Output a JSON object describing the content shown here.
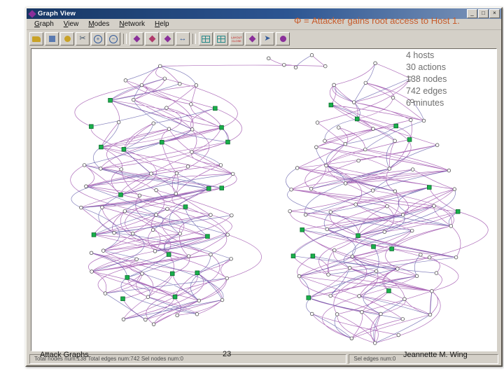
{
  "slide": {
    "title_overlay": "Φ = Attacker gains root access to Host 1.",
    "stats": [
      "4 hosts",
      "30 actions",
      "138 nodes",
      "742 edges",
      "6 minutes"
    ],
    "footer_left": "Attack Graphs",
    "footer_center": "23",
    "footer_right": "Jeannette M. Wing"
  },
  "window": {
    "title": "Graph View",
    "controls": {
      "minimize": "_",
      "maximize": "□",
      "close": "×"
    },
    "menus": [
      "Graph",
      "View",
      "Modes",
      "Network",
      "Help"
    ],
    "toolbar": {
      "layout_label": "LAYOUT",
      "close_label": "CLOSE",
      "icons": [
        {
          "name": "open-graph-icon",
          "shape": "folder",
          "color": "#c9a227"
        },
        {
          "name": "save-graph-icon",
          "shape": "square",
          "color": "#5a7ab0"
        },
        {
          "name": "key-icon",
          "shape": "circle",
          "color": "#c9a227"
        },
        {
          "name": "cut-icon",
          "shape": "glyph",
          "glyph": "✂",
          "color": "#3b4f66"
        },
        {
          "name": "zoom-in-icon",
          "shape": "mag",
          "glyph": "+",
          "color": "#335a9a"
        },
        {
          "name": "zoom-out-icon",
          "shape": "mag",
          "glyph": "−",
          "color": "#335a9a"
        },
        {
          "name": "sep1",
          "shape": "sep"
        },
        {
          "name": "select-node-icon",
          "shape": "diamond",
          "color": "#8a2f9a"
        },
        {
          "name": "select-edge-icon",
          "shape": "diamond",
          "color": "#b03a6a"
        },
        {
          "name": "expand-graph-icon",
          "shape": "diamond",
          "color": "#8a2f9a"
        },
        {
          "name": "fit-view-icon",
          "shape": "glyph",
          "glyph": "↔",
          "color": "#335a9a"
        },
        {
          "name": "sep2",
          "shape": "sep"
        },
        {
          "name": "table-view-icon",
          "shape": "grid",
          "color": "#2a8a8a"
        },
        {
          "name": "matrix-view-icon",
          "shape": "grid",
          "color": "#2a8a8a"
        },
        {
          "name": "layout-close-button",
          "shape": "redtext"
        },
        {
          "name": "mode-icon",
          "shape": "diamond",
          "color": "#8a2f9a"
        },
        {
          "name": "pan-icon",
          "shape": "glyph",
          "glyph": "➤",
          "color": "#335a9a"
        },
        {
          "name": "node-info-icon",
          "shape": "circle",
          "color": "#8a2f9a"
        }
      ]
    },
    "statusbar": {
      "left": "Total nodes num:138   Total edges num:742   Sel nodes num:0",
      "right": "Sel edges num:0"
    }
  },
  "graph": {
    "nodes": 138,
    "edges": 742,
    "seed": 20051,
    "colors": {
      "edge": "#8b2f9c",
      "edge_alt": "#4f48a0",
      "node_fill": "#ffffff",
      "node_stroke": "#3a3a3a",
      "green_fill": "#19b04b",
      "green_stroke": "#0c6e2d"
    }
  }
}
